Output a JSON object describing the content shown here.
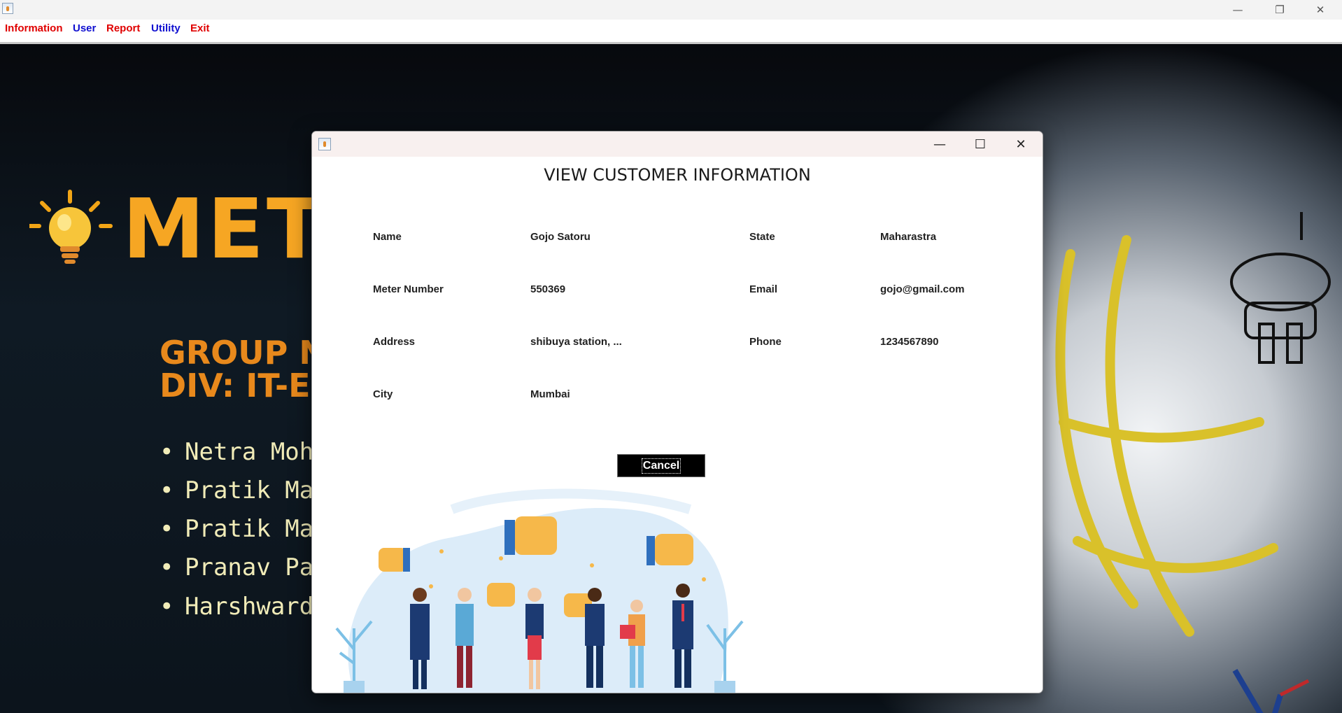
{
  "window": {
    "minimize": "—",
    "restore": "❐",
    "close": "✕"
  },
  "menu": [
    {
      "label": "Information",
      "color": "#e00000"
    },
    {
      "label": "User",
      "color": "#1010d0"
    },
    {
      "label": "Report",
      "color": "#e00000"
    },
    {
      "label": "Utility",
      "color": "#1010d0"
    },
    {
      "label": "Exit",
      "color": "#e00000"
    }
  ],
  "background": {
    "title": "MET",
    "group_line_1": "GROUP N",
    "group_line_2": "DIV: IT-E",
    "members": [
      "Netra Moh",
      "Pratik Man",
      "Pratik Man",
      "Pranav Pat",
      "Harshward"
    ]
  },
  "dialog": {
    "minimize": "—",
    "maximize": "☐",
    "close": "✕",
    "heading": "VIEW CUSTOMER INFORMATION",
    "fields": {
      "name_label": "Name",
      "name_value": "Gojo Satoru",
      "state_label": "State",
      "state_value": "Maharastra",
      "meter_label": "Meter Number",
      "meter_value": "550369",
      "email_label": "Email",
      "email_value": "gojo@gmail.com",
      "address_label": "Address",
      "address_value": "shibuya station, ...",
      "phone_label": "Phone",
      "phone_value": "1234567890",
      "city_label": "City",
      "city_value": "Mumbai"
    },
    "cancel_label": "Cancel"
  }
}
